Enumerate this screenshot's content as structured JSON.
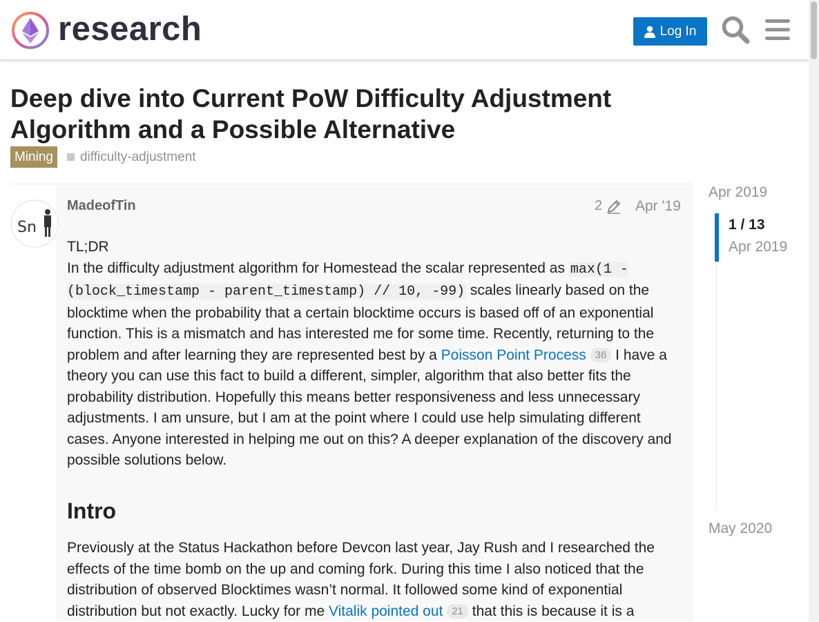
{
  "header": {
    "logo_text": "research",
    "login_label": "Log In",
    "icons": [
      "user-icon",
      "search-icon",
      "hamburger-menu-icon"
    ],
    "brand_color": "#0a74c6"
  },
  "topic": {
    "title": "Deep dive into Current PoW Difficulty Adjustment Algorithm and a Possible Alternative",
    "category": "Mining",
    "category_color": "#a6915c",
    "tag": "difficulty-adjustment"
  },
  "post": {
    "username": "MadeofTin",
    "avatar_text": "Sn",
    "edit_count": "2",
    "date": "Apr '19",
    "tldr": "TL;DR",
    "p1_a": "In the difficulty adjustment algorithm for Homestead the scalar represented as ",
    "code": "max(1 - (block_timestamp - parent_timestamp) // 10, -99)",
    "p1_b": " scales linearly based on the blocktime when the probability that a certain blocktime occurs is based off of an exponential function. This is a mismatch and has interested me for some time. Recently, returning to the problem and after learning they are represented best by a ",
    "link1": "Poisson Point Process",
    "link1_count": "36",
    "p1_c": " I have a theory you can use this fact to build a different, simpler, algorithm that also better fits the probability distribution. Hopefully this means better responsiveness and less unnecessary adjustments. I am unsure, but I am at the point where I could use help simulating different cases. Anyone interested in helping me out on this? A deeper explanation of the discovery and possible solutions below.",
    "heading": "Intro",
    "p2_a": "Previously at the Status Hackathon before Devcon last year, Jay Rush and I researched the effects of the time bomb on the up and coming fork. During this time I also noticed that the distribution of observed Blocktimes wasn’t normal. It followed some kind of exponential distribution but not exactly. Lucky for me ",
    "link2": "Vitalik pointed out",
    "link2_count": "21",
    "p2_b": " that this is because it is a"
  },
  "timeline": {
    "start": "Apr 2019",
    "position": "1 / 13",
    "current_date": "Apr 2019",
    "end": "May 2020"
  }
}
